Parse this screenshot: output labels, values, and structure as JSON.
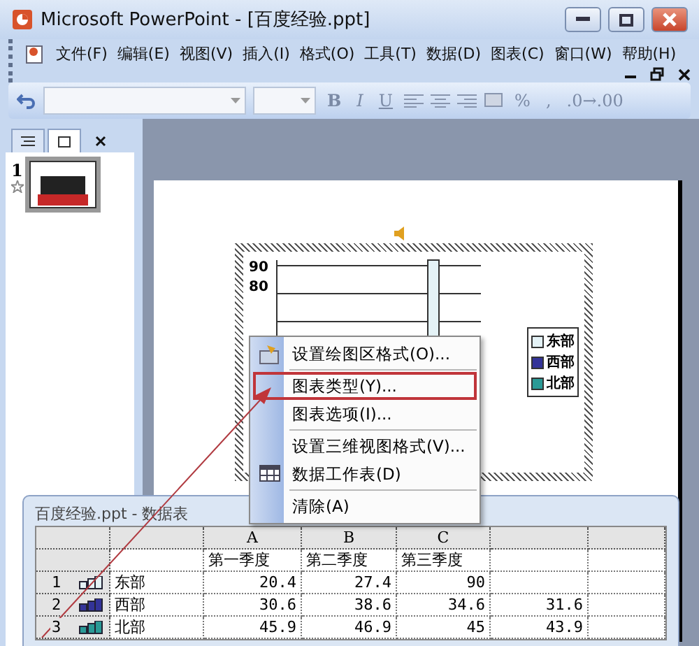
{
  "window": {
    "title": "Microsoft PowerPoint - [百度经验.ppt]"
  },
  "menu": [
    "文件(F)",
    "编辑(E)",
    "视图(V)",
    "插入(I)",
    "格式(O)",
    "工具(T)",
    "数据(D)",
    "图表(C)",
    "窗口(W)",
    "帮助(H)"
  ],
  "toolbar": {
    "format_buttons": [
      "B",
      "I",
      "U"
    ],
    "number_buttons": [
      "%",
      ",",
      ".0→.00"
    ]
  },
  "slide_pane": {
    "tabs": [
      {
        "kind": "outline",
        "selected": false
      },
      {
        "kind": "slides",
        "selected": true
      }
    ],
    "slides": [
      {
        "number": "1",
        "selected": true
      }
    ]
  },
  "chart": {
    "y_ticks": [
      "90",
      "80"
    ],
    "legend": [
      {
        "label": "东部",
        "color": "#e4f2f6"
      },
      {
        "label": "西部",
        "color": "#333399"
      },
      {
        "label": "北部",
        "color": "#2a9a96"
      }
    ]
  },
  "context_menu": {
    "items": [
      {
        "label": "设置绘图区格式(O)...",
        "kind": "format",
        "separator_before": false,
        "highlighted": false
      },
      {
        "label": "图表类型(Y)...",
        "kind": "plain",
        "separator_before": true,
        "highlighted": true
      },
      {
        "label": "图表选项(I)...",
        "kind": "plain",
        "separator_before": false,
        "highlighted": false
      },
      {
        "label": "设置三维视图格式(V)...",
        "kind": "plain",
        "separator_before": true,
        "highlighted": false
      },
      {
        "label": "数据工作表(D)",
        "kind": "sheet",
        "separator_before": false,
        "highlighted": false
      },
      {
        "label": "清除(A)",
        "kind": "plain",
        "separator_before": true,
        "highlighted": false
      }
    ]
  },
  "datasheet": {
    "title": "百度经验.ppt - 数据表",
    "columns": [
      "A",
      "B",
      "C"
    ],
    "series_names": [
      "第一季度",
      "第二季度",
      "第三季度"
    ],
    "rows": [
      {
        "number": "1",
        "label": "东部",
        "color": "#e4f2f6",
        "values": [
          "20.4",
          "27.4",
          "90"
        ]
      },
      {
        "number": "2",
        "label": "西部",
        "color": "#333399",
        "values": [
          "30.6",
          "38.6",
          "34.6",
          "31.6"
        ]
      },
      {
        "number": "3",
        "label": "北部",
        "color": "#2a9a96",
        "values": [
          "45.9",
          "46.9",
          "45",
          "43.9"
        ]
      }
    ]
  }
}
